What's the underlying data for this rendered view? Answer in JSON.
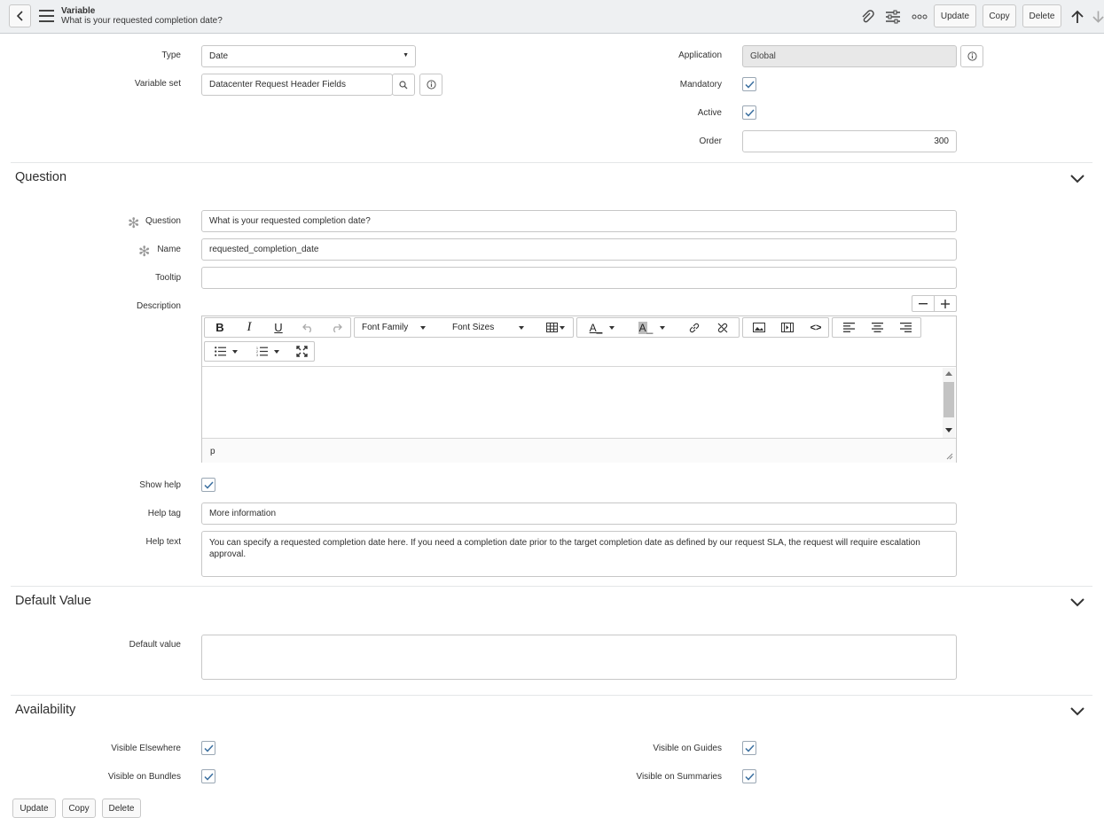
{
  "header": {
    "title": "Variable",
    "subtitle": "What is your requested completion date?",
    "buttons": {
      "update": "Update",
      "copy": "Copy",
      "delete": "Delete"
    },
    "icons": [
      "back-icon",
      "menu-icon",
      "attachment-icon",
      "settings-sliders-icon",
      "more-icon",
      "arrow-up-icon",
      "arrow-down-icon"
    ]
  },
  "top_form": {
    "type_label": "Type",
    "type_value": "Date",
    "variable_set_label": "Variable set",
    "variable_set_value": "Datacenter Request Header Fields",
    "application_label": "Application",
    "application_value": "Global",
    "mandatory_label": "Mandatory",
    "mandatory_checked": true,
    "active_label": "Active",
    "active_checked": true,
    "order_label": "Order",
    "order_value": "300"
  },
  "question_section": {
    "title": "Question",
    "question_label": "Question",
    "question_value": "What is your requested completion date?",
    "name_label": "Name",
    "name_value": "requested_completion_date",
    "tooltip_label": "Tooltip",
    "tooltip_value": "",
    "description_label": "Description",
    "editor": {
      "font_family": "Font Family",
      "font_sizes": "Font Sizes",
      "status_path": "p"
    },
    "show_help_label": "Show help",
    "show_help_checked": true,
    "help_tag_label": "Help tag",
    "help_tag_value": "More information",
    "help_text_label": "Help text",
    "help_text_value": "You can specify a requested completion date here. If you need a completion date prior to the target completion date as defined by our request SLA, the request will require escalation approval."
  },
  "default_section": {
    "title": "Default Value",
    "default_value_label": "Default value",
    "default_value": ""
  },
  "availability_section": {
    "title": "Availability",
    "visible_elsewhere_label": "Visible Elsewhere",
    "visible_bundles_label": "Visible on Bundles",
    "visible_guides_label": "Visible on Guides",
    "visible_summaries_label": "Visible on Summaries"
  },
  "colors": {
    "header_bg": "#eef0f2",
    "check": "#3a6fa0",
    "readonly_bg": "#e8e8e8"
  }
}
